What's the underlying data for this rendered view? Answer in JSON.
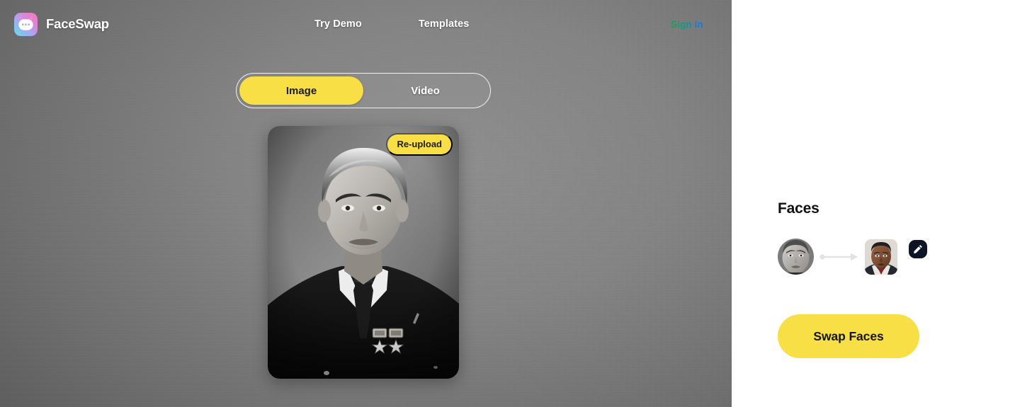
{
  "header": {
    "brand_name": "FaceSwap",
    "logo_icon": "cat-face-icon",
    "nav": [
      {
        "label": "Try Demo",
        "icon": ""
      },
      {
        "label": "Templates",
        "icon": ""
      }
    ],
    "signin_label": "Sign In",
    "signin_color": "#169b7e"
  },
  "mode_toggle": {
    "options": [
      {
        "label": "Image",
        "active": true
      },
      {
        "label": "Video",
        "active": false
      }
    ],
    "active_color": "#f7df45"
  },
  "canvas": {
    "reupload_label": "Re-upload",
    "photo_alt": "black-and-white portrait of a man in a dark suit with star medals",
    "badge_color": "#f7df45"
  },
  "panel": {
    "title": "Faces",
    "faces": [
      {
        "role": "source",
        "shape": "circle",
        "alt": "grayscale source face"
      },
      {
        "role": "target",
        "shape": "rounded-square",
        "alt": "color target face"
      }
    ],
    "arrow_icon": "arrow-right-icon",
    "edit_icon": "pencil-icon",
    "swap_button_label": "Swap Faces",
    "swap_button_color": "#f7df45"
  }
}
